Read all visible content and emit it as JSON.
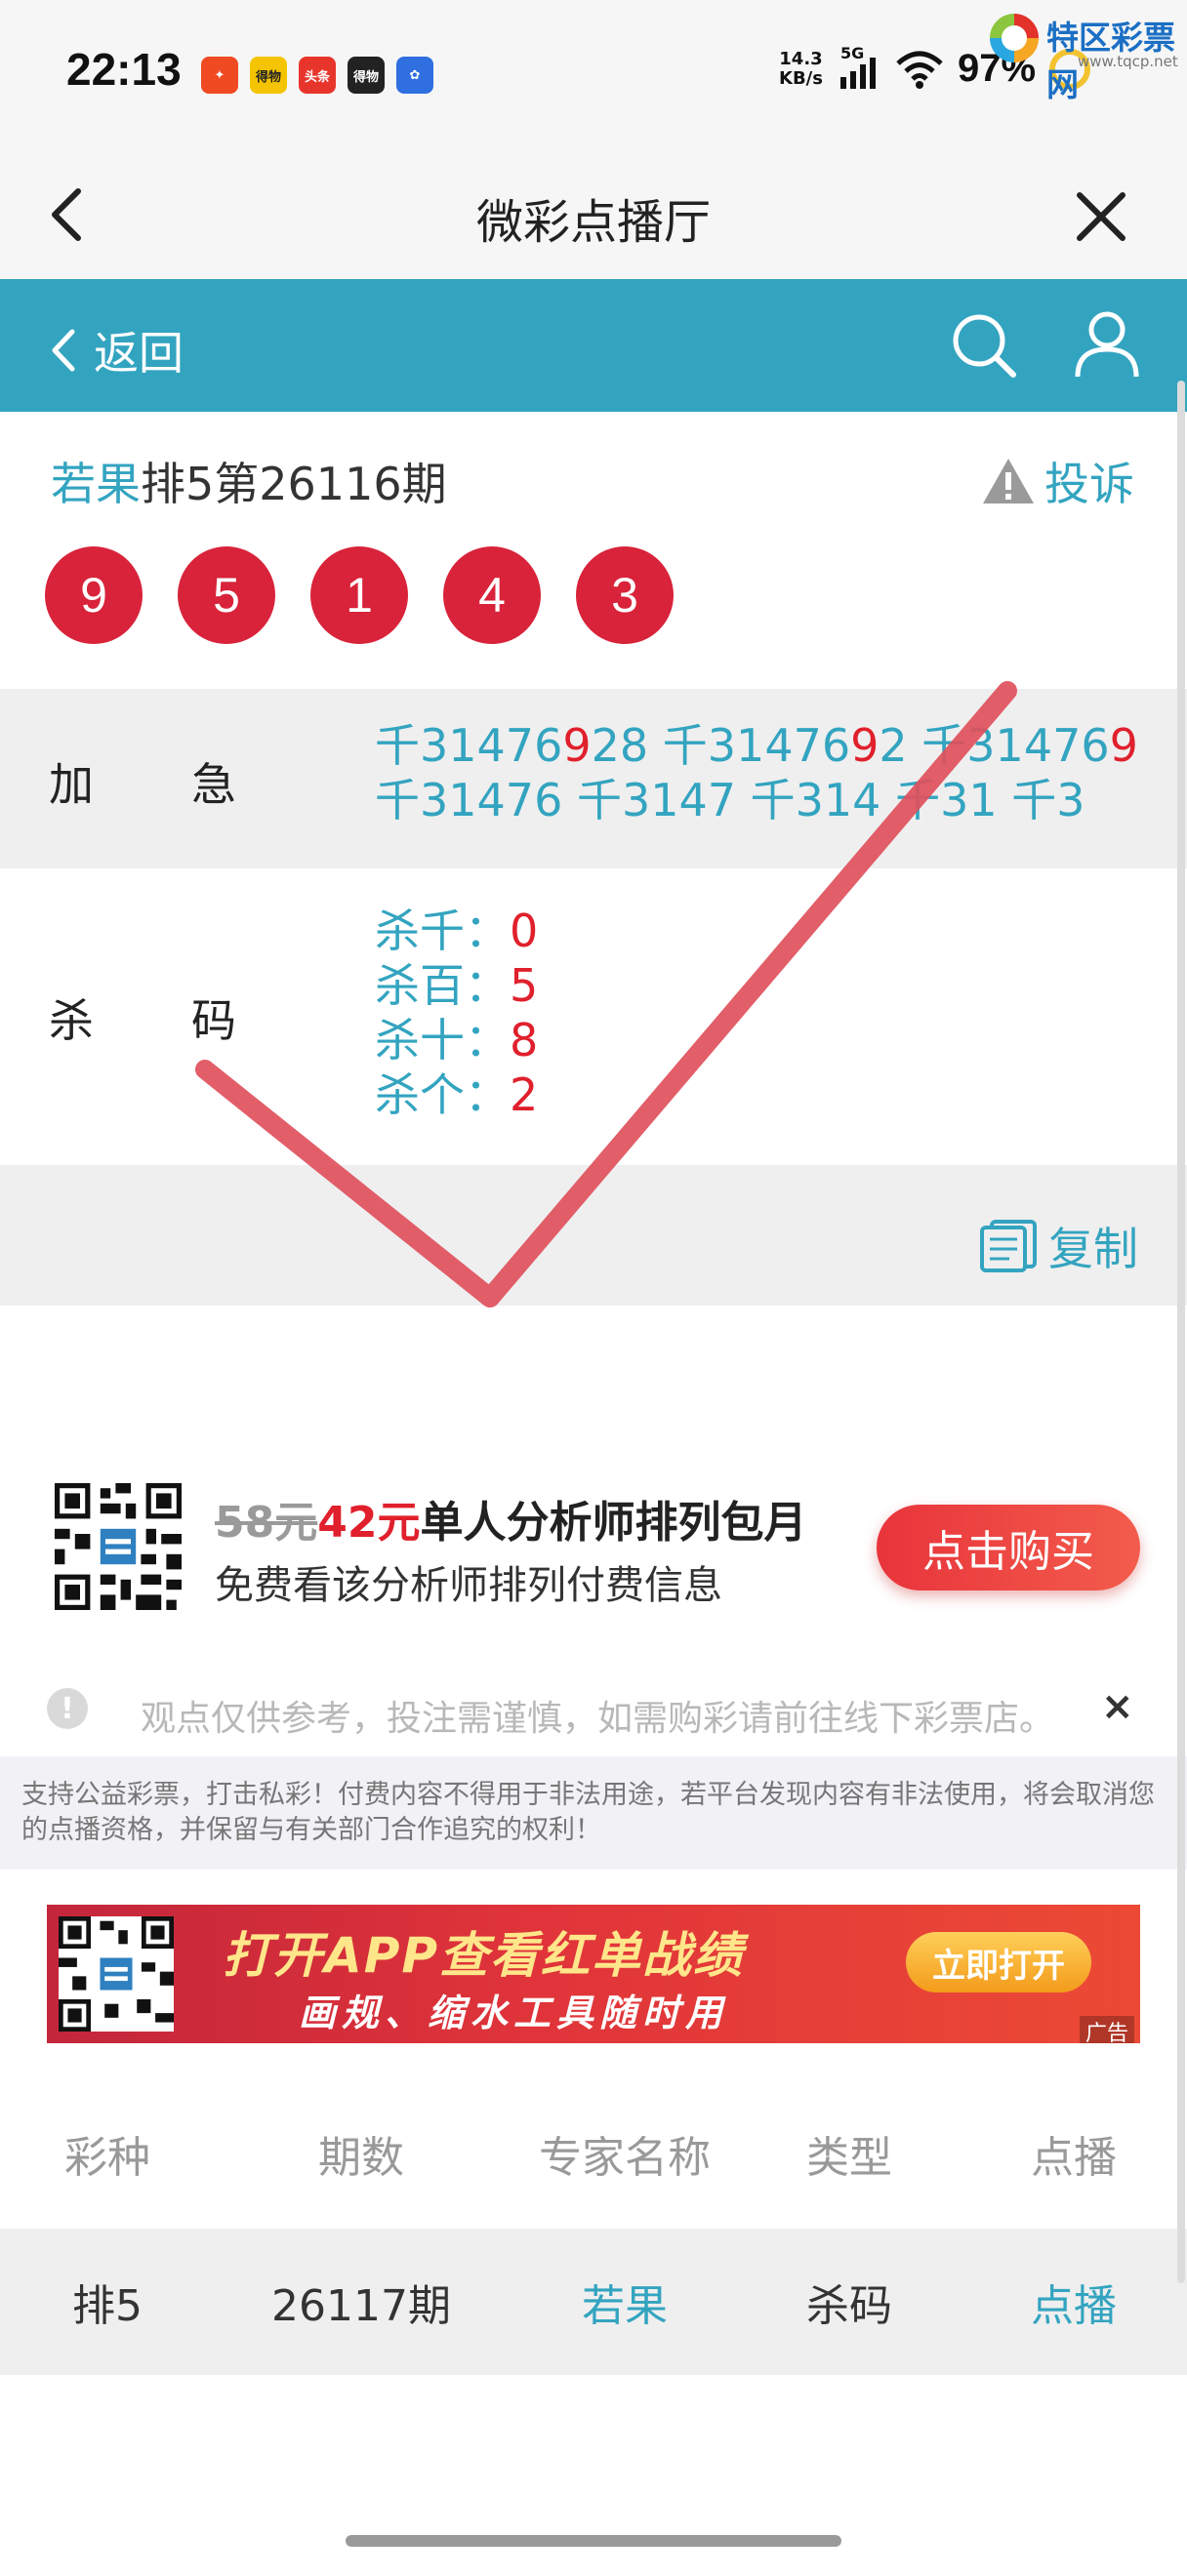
{
  "status_bar": {
    "time": "22:13",
    "app_icons": [
      {
        "name": "shopping-app-icon",
        "text": "✦",
        "color": "#f04a23"
      },
      {
        "name": "news-app-icon",
        "text": "得物",
        "color": "#f5c400"
      },
      {
        "name": "toutiao-icon",
        "text": "头条",
        "color": "#e8352c"
      },
      {
        "name": "dark-app-icon",
        "text": "得物",
        "color": "#222222"
      },
      {
        "name": "baidu-icon",
        "text": "✿",
        "color": "#2f6fe0"
      }
    ],
    "net_speed_value": "14.3",
    "net_speed_unit": "KB/s",
    "network_type": "5G",
    "battery": "97%"
  },
  "watermark": {
    "title": "特区彩票网",
    "url": "www.tqcp.net"
  },
  "titlebar": {
    "title": "微彩点播厅"
  },
  "navbar": {
    "back_label": "返回"
  },
  "draw": {
    "expert": "若果",
    "issue": "排5第26116期",
    "complain_label": "投诉",
    "numbers": [
      "9",
      "5",
      "1",
      "4",
      "3"
    ]
  },
  "urgent": {
    "label_1": "加",
    "label_2": "急",
    "line1": [
      {
        "text": "千31476",
        "hl": false
      },
      {
        "text": "9",
        "hl": true
      },
      {
        "text": "28 千31476",
        "hl": false
      },
      {
        "text": "9",
        "hl": true
      },
      {
        "text": "2 千314769",
        "hl": false
      }
    ],
    "line1_last_hl": "9",
    "line2": "千31476 千3147 千314 千31 千3"
  },
  "kill": {
    "label_1": "杀",
    "label_2": "码",
    "items": [
      {
        "key": "杀千：",
        "value": "0"
      },
      {
        "key": "杀百：",
        "value": "5"
      },
      {
        "key": "杀十：",
        "value": "8"
      },
      {
        "key": "杀个：",
        "value": "2"
      }
    ]
  },
  "copy": {
    "label": "复制"
  },
  "purchase": {
    "old_price": "58元",
    "new_price": "42元",
    "desc": "单人分析师排列包月",
    "sub": "免费看该分析师排列付费信息",
    "button": "点击购买"
  },
  "notice": {
    "icon": "!",
    "text": "观点仅供参考，投注需谨慎，如需购彩请前往线下彩票店。",
    "close": "×"
  },
  "disclaimer": "支持公益彩票，打击私彩！付费内容不得用于非法用途，若平台发现内容有非法使用，将会取消您的点播资格，并保留与有关部门合作追究的权利！",
  "banner": {
    "title": "打开APP查看红单战绩",
    "sub": "画规、缩水工具随时用",
    "button": "立即打开",
    "ad_tag": "广告"
  },
  "table": {
    "headers": [
      "彩种",
      "期数",
      "专家名称",
      "类型",
      "点播"
    ],
    "rows": [
      [
        "排5",
        "26117期",
        "若果",
        "杀码",
        "点播"
      ]
    ]
  },
  "colors": {
    "accent": "#33a4c0",
    "ball_red": "#d8233a",
    "highlight_red": "#e0202c",
    "check_mark": "#e0505c"
  }
}
